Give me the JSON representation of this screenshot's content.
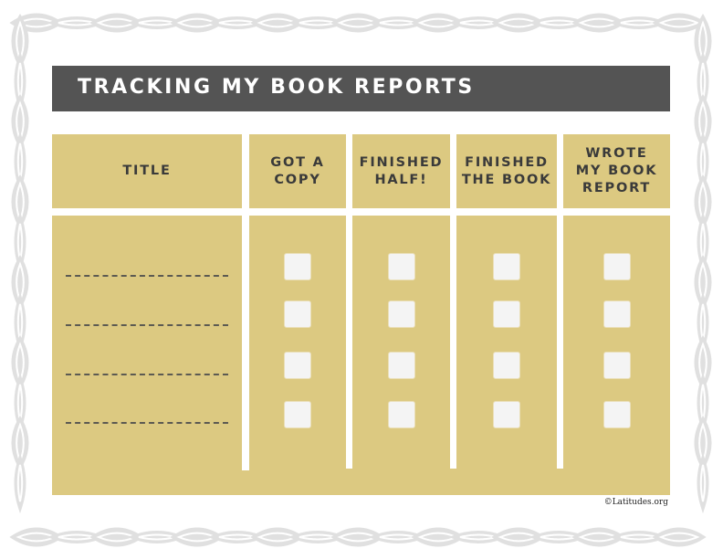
{
  "page": {
    "title": "TRACKING MY BOOK REPORTS",
    "copyright": "©Latitudes.org"
  },
  "colors": {
    "title_bar": "#545454",
    "table_fill": "#dcc981",
    "checkbox_fill": "#f4f4f4",
    "border_ornament": "#e0e0e0",
    "header_text": "#3a3a3a"
  },
  "table": {
    "columns": [
      {
        "key": "title",
        "label": "TITLE"
      },
      {
        "key": "got_copy",
        "label": "GOT A\nCOPY"
      },
      {
        "key": "finished_half",
        "label": "FINISHED\nHALF!"
      },
      {
        "key": "finished_book",
        "label": "FINISHED\nTHE BOOK"
      },
      {
        "key": "wrote_report",
        "label": "WROTE\nMY BOOK\nREPORT"
      }
    ],
    "rows": [
      {
        "title": "",
        "got_copy": false,
        "finished_half": false,
        "finished_book": false,
        "wrote_report": false
      },
      {
        "title": "",
        "got_copy": false,
        "finished_half": false,
        "finished_book": false,
        "wrote_report": false
      },
      {
        "title": "",
        "got_copy": false,
        "finished_half": false,
        "finished_book": false,
        "wrote_report": false
      },
      {
        "title": "",
        "got_copy": false,
        "finished_half": false,
        "finished_book": false,
        "wrote_report": false
      }
    ]
  }
}
